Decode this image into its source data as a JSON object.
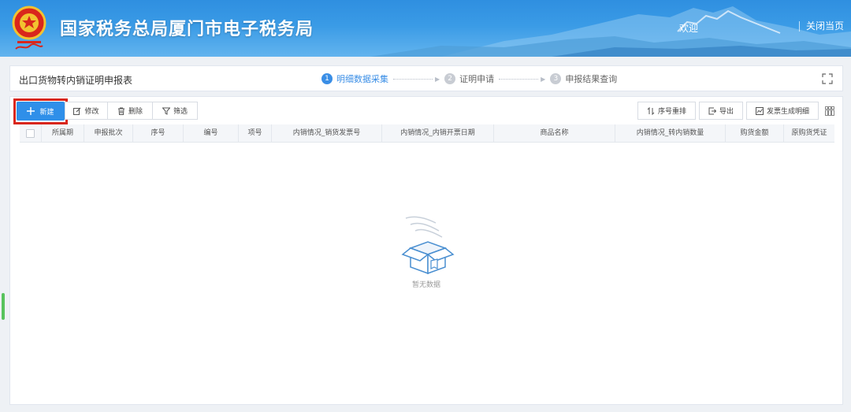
{
  "header": {
    "site_title": "国家税务总局厦门市电子税务局",
    "welcome": "欢迎",
    "close_page": "关闭当页",
    "colors": {
      "banner": "#3a9be6"
    }
  },
  "title_bar": {
    "form_title": "出口货物转内销证明申报表",
    "steps": [
      {
        "num": "1",
        "label": "明细数据采集",
        "active": true
      },
      {
        "num": "2",
        "label": "证明申请",
        "active": false
      },
      {
        "num": "3",
        "label": "申报结果查询",
        "active": false
      }
    ]
  },
  "toolbar": {
    "new_label": "新建",
    "edit_label": "修改",
    "delete_label": "删除",
    "filter_label": "筛选",
    "reorder_label": "序号重排",
    "export_label": "导出",
    "generate_label": "发票生成明细"
  },
  "table": {
    "columns": [
      "所属期",
      "申报批次",
      "序号",
      "编号",
      "项号",
      "内销情况_销货发票号",
      "内销情况_内销开票日期",
      "商品名称",
      "内销情况_转内销数量",
      "购货金额",
      "原购货凭证"
    ],
    "rows": []
  },
  "empty_state": {
    "text": "暂无数据"
  },
  "icons": [
    "plus-icon",
    "edit-icon",
    "trash-icon",
    "filter-icon",
    "sort-icon",
    "export-icon",
    "chart-icon",
    "fullscreen-icon",
    "column-settings-icon",
    "empty-box-icon",
    "emblem-icon"
  ],
  "accent_color": "#2f8fe9",
  "highlight_color": "#d9261c"
}
